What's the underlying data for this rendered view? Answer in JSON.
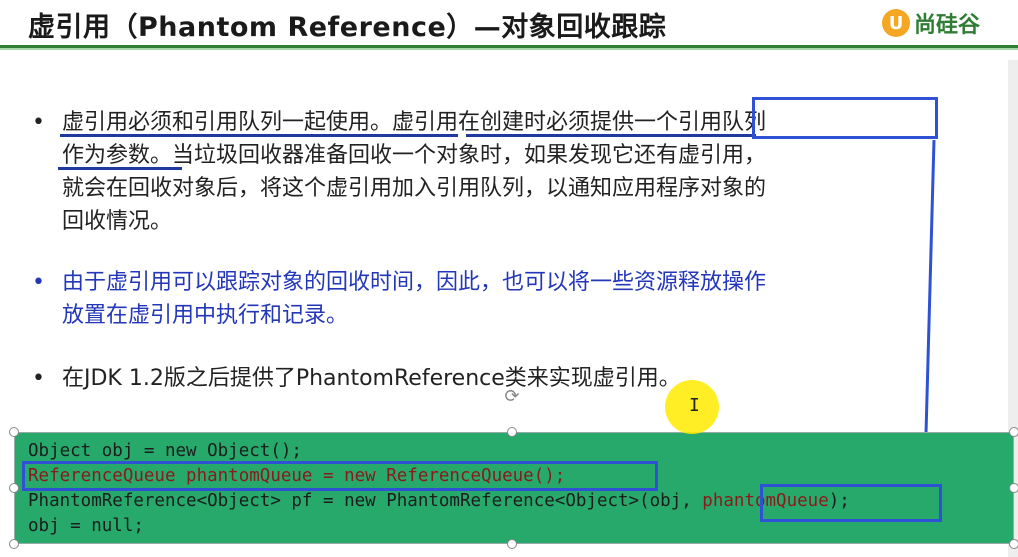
{
  "slide": {
    "title": "虚引用（Phantom Reference）—对象回收跟踪",
    "logo": {
      "badge": "U",
      "name": "尚硅谷"
    }
  },
  "bullets": [
    {
      "marker": "•",
      "lines": [
        "虚引用必须和引用队列一起使用。虚引用在创建时必须提供一个引用队列",
        "作为参数。当垃圾回收器准备回收一个对象时，如果发现它还有虚引用，",
        "就会在回收对象后，将这个虚引用加入引用队列，以通知应用程序对象的",
        "回收情况。"
      ]
    },
    {
      "marker": "•",
      "lines": [
        "由于虚引用可以跟踪对象的回收时间，因此，也可以将一些资源释放操作",
        "放置在虚引用中执行和记录。"
      ]
    },
    {
      "marker": "•",
      "lines": [
        "在JDK 1.2版之后提供了PhantomReference类来实现虚引用。"
      ]
    }
  ],
  "code": {
    "line1": "Object obj = new Object();",
    "line2": "ReferenceQueue phantomQueue = new ReferenceQueue();",
    "line3_prefix": "PhantomReference<Object> pf = new PhantomReference<Object>(obj, ",
    "line3_arg": "phantomQueue",
    "line3_suffix": ");",
    "line4": "obj = null;"
  },
  "colors": {
    "title_rule": "#2e7d32",
    "code_bg": "#26a96b",
    "annotation_blue": "#2f52d4",
    "bullet2_text": "#2337b8",
    "highlight_code": "#8b1a1a",
    "cursor_halo": "#ffeb00"
  },
  "icons": {
    "rotate": "rotate-handle-icon",
    "cursor": "text-cursor-icon"
  }
}
